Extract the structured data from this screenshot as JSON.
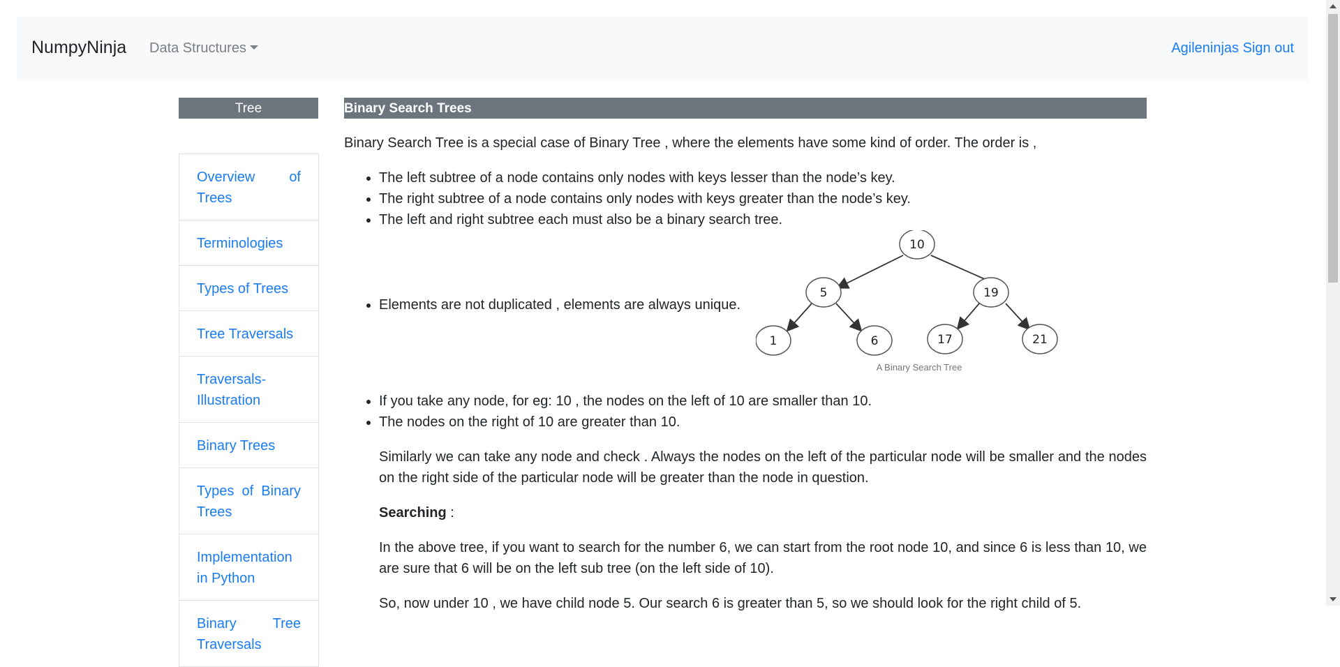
{
  "navbar": {
    "brand": "NumpyNinja",
    "dropdown_label": "Data Structures",
    "user": "Agileninjas",
    "signout": "Sign out"
  },
  "sidebar": {
    "header": "Tree",
    "items": [
      {
        "label": "Overview of Trees"
      },
      {
        "label": "Terminologies"
      },
      {
        "label": "Types of Trees"
      },
      {
        "label": "Tree Traversals"
      },
      {
        "label": "Traversals-Illustration"
      },
      {
        "label": "Binary Trees"
      },
      {
        "label": "Types of Binary Trees"
      },
      {
        "label": "Implementation in Python"
      },
      {
        "label": "Binary Tree Traversals"
      }
    ]
  },
  "main": {
    "title": "Binary Search Trees",
    "intro": "Binary Search Tree is a special case of Binary Tree , where the elements have some kind of order. The order is ,",
    "bullets1": [
      "The left subtree of a node contains only nodes with keys lesser than the node’s key.",
      "The right subtree of a node contains only nodes with keys greater than the node’s key.",
      "The left and right subtree each must also be a binary search tree."
    ],
    "bullet_unique": "Elements are not duplicated , elements are always unique.",
    "tree": {
      "nodes": [
        "10",
        "5",
        "19",
        "1",
        "6",
        "17",
        "21"
      ],
      "caption": "A Binary Search Tree"
    },
    "bullets2": [
      "If you take any node, for eg: 10 , the nodes on the left of 10 are smaller than 10.",
      "The nodes on the right of 10 are greater than 10."
    ],
    "para_similarly": "Similarly we can take any node and check . Always the nodes on the left of the particular node will be smaller and the nodes on the right side of the particular node will be greater than the node in question.",
    "searching_label": "Searching",
    "searching_colon": " :",
    "para_search": "In the above tree, if you want to search for the number 6, we can start from the root node 10, and since 6 is less than 10, we are sure that 6 will be on the left sub tree (on the left side of 10).",
    "para_cut": "So, now under 10 , we have child node 5. Our search 6 is greater than 5, so we should look for the right child of 5."
  },
  "colors": {
    "link": "#1a7cf3",
    "header_bg": "#6c757d",
    "navbar_bg": "#f8f9fa"
  }
}
